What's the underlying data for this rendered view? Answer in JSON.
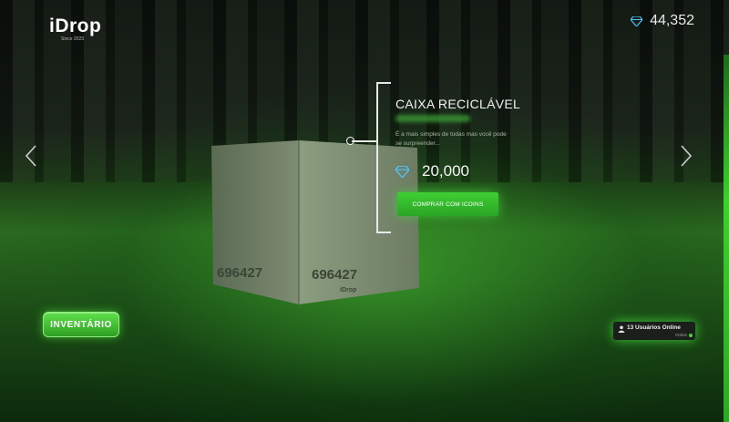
{
  "brand": {
    "logo": "iDrop",
    "tagline": "Since 2023"
  },
  "balance": {
    "icon": "diamond-icon",
    "value": "44,352",
    "color": "#4fc3f7"
  },
  "case": {
    "title": "CAIXA RECICLÁVEL",
    "description": "É a mais simples de todas mas você pode se surpreender...",
    "box_labels": [
      "696427",
      "696427"
    ],
    "box_brand": "iDrop",
    "price": {
      "icon": "diamond-icon",
      "value": "20,000"
    },
    "buy_label": "COMPRAR COM ICOINS"
  },
  "navigation": {
    "prev_icon": "chevron-left-icon",
    "next_icon": "chevron-right-icon"
  },
  "inventory": {
    "label": "INVENTÁRIO"
  },
  "online": {
    "label": "13 Usuários Online",
    "status": "Online",
    "icon": "user-icon"
  },
  "colors": {
    "accent": "#3fcf34",
    "background": "#0b1a0c"
  }
}
